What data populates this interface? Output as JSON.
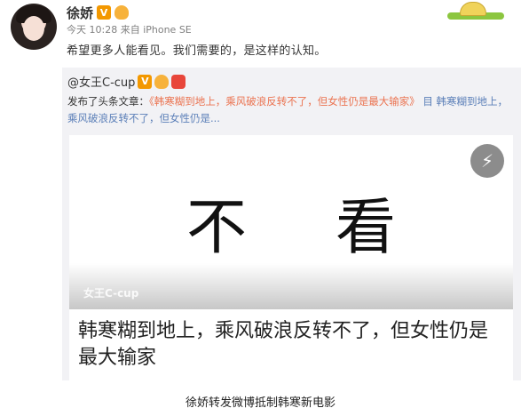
{
  "post": {
    "username": "徐娇",
    "meta": "今天 10:28 来自 iPhone SE",
    "content": "希望更多人能看见。我们需要的，是这样的认知。"
  },
  "repost": {
    "original_username": "@女王C-cup",
    "text_prefix": "发布了头条文章：",
    "article_link": "《韩寒糊到地上，乘风破浪反转不了，但女性仍是最大输家》",
    "link_tail": "目 韩寒糊到地上，乘风破浪反转不了，但女性仍是..."
  },
  "card": {
    "headline": "不看",
    "watermark": "女王C-cup",
    "title": "韩寒糊到地上，乘风破浪反转不了，但女性仍是最大输家"
  },
  "caption": "徐娇转发微博抵制韩寒新电影",
  "icons": {
    "verified": "V",
    "lightning": "⚡"
  }
}
